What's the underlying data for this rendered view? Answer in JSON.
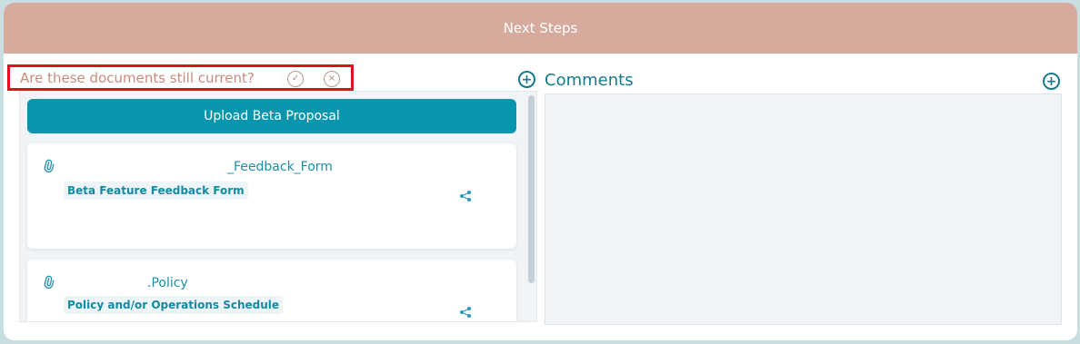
{
  "panel": {
    "title": "Next Steps"
  },
  "question": {
    "text": "Are these documents still current?",
    "confirm_icon": "✓",
    "reject_icon": "×"
  },
  "documents": {
    "add_icon": "+",
    "upload_button_label": "Upload Beta Proposal",
    "items": [
      {
        "name": "_Feedback_Form",
        "tag": "Beta Feature Feedback Form"
      },
      {
        "name": ".Policy",
        "tag": "Policy and/or Operations Schedule"
      }
    ]
  },
  "comments": {
    "title": "Comments",
    "add_icon": "+"
  },
  "colors": {
    "header_bg": "#d6aa9d",
    "accent_teal": "#0895ae",
    "question_text": "#c98c7c",
    "highlight_border": "#e0121e"
  },
  "icons": [
    "check-circle-icon",
    "x-circle-icon",
    "plus-circle-icon",
    "paperclip-icon",
    "share-icon"
  ]
}
